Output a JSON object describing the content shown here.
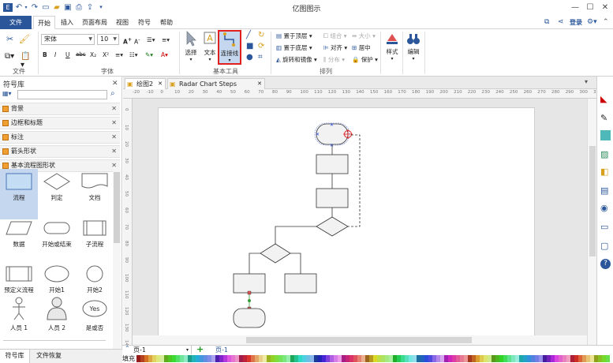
{
  "app": {
    "title": "亿图图示"
  },
  "quick_access": [
    "app-icon",
    "undo-icon",
    "undo-dropdown-icon",
    "redo-icon",
    "new-icon",
    "open-icon",
    "save-icon",
    "print-icon",
    "export-icon",
    "quick-access-dropdown-icon"
  ],
  "tabs": [
    {
      "label": "文件"
    },
    {
      "label": "开始"
    },
    {
      "label": "插入"
    },
    {
      "label": "页面布局"
    },
    {
      "label": "视图"
    },
    {
      "label": "符号"
    },
    {
      "label": "帮助"
    }
  ],
  "ribbon_right": {
    "login": "登录"
  },
  "ribbon": {
    "file_group": {
      "label": "文件"
    },
    "font_group": {
      "label": "字体",
      "font_name": "宋体",
      "font_size": "10",
      "buttons": [
        "B",
        "I",
        "U",
        "abc",
        "X₂",
        "X²"
      ]
    },
    "basic_tools": {
      "label": "基本工具",
      "select": "选择",
      "text": "文本",
      "connector": "连接线"
    },
    "arrange": {
      "label": "排列",
      "bring_front": "置于顶层",
      "send_back": "置于底层",
      "rotate_mirror": "旋转和镜像",
      "group": "组合",
      "align": "对齐",
      "distribute": "分布",
      "size": "大小",
      "center": "居中",
      "protect": "保护"
    },
    "style": {
      "label": "样式"
    },
    "edit": {
      "label": "编辑"
    }
  },
  "library": {
    "title": "符号库",
    "search_placeholder": "",
    "categories": [
      "背景",
      "边框和标题",
      "标注",
      "箭头形状",
      "基本流程图形状"
    ],
    "shapes": [
      "流程",
      "判定",
      "文档",
      "数据",
      "开始或结束",
      "子流程",
      "预定义流程",
      "开始1",
      "开始2",
      "人员 1",
      "人员 2",
      "是或否"
    ],
    "yes_text": "Yes"
  },
  "documents": [
    {
      "label": "绘图2"
    },
    {
      "label": "Radar Chart Steps"
    }
  ],
  "ruler": {
    "h": [
      "-20",
      "-10",
      "0",
      "10",
      "20",
      "30",
      "40",
      "50",
      "60",
      "70",
      "80",
      "90",
      "100",
      "110",
      "120",
      "130",
      "140",
      "150",
      "160",
      "170",
      "180",
      "190",
      "200",
      "210",
      "220",
      "230",
      "240",
      "250",
      "260",
      "270",
      "280",
      "290",
      "300",
      "310"
    ],
    "v": [
      "0",
      "10",
      "20",
      "30",
      "40",
      "50",
      "60",
      "70",
      "80",
      "90",
      "100",
      "110",
      "120",
      "130",
      "140"
    ]
  },
  "bottom": {
    "panel_tabs": [
      "符号库",
      "文件恢复"
    ],
    "page_selector": "页-1",
    "page_tab": "页-1",
    "fill_label": "填充"
  },
  "colors": {
    "accent": "#2b579a",
    "selection": "#c5d7ef",
    "highlight_border": "#e02020",
    "handle": "#2040e0",
    "connector_guide": "#3a9a3a"
  },
  "right_tools": [
    "fill-icon",
    "line-icon",
    "shadow-icon",
    "image-icon",
    "layers-icon",
    "page-icon",
    "theme-icon",
    "notes-icon",
    "comment-icon",
    "help-icon"
  ]
}
